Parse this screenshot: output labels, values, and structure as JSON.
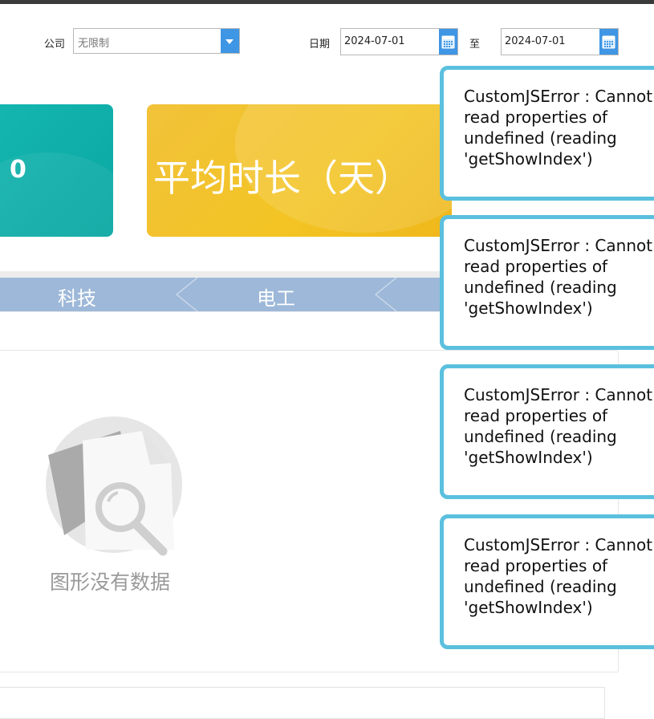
{
  "filters": {
    "company_label": "公司",
    "company_value": "无限制",
    "date_label": "日期",
    "date_from": "2024-07-01",
    "to_label": "至",
    "date_to": "2024-07-01"
  },
  "cards": {
    "teal_value": "0",
    "yellow_title": "平均时长（天）"
  },
  "tabs": [
    "科技",
    "电工"
  ],
  "empty_state": {
    "message": "图形没有数据"
  },
  "errors": [
    "CustomJSError : Cannot read properties of undefined (reading 'getShowIndex')",
    "CustomJSError : Cannot read properties of undefined (reading 'getShowIndex')",
    "CustomJSError : Cannot read properties of undefined (reading 'getShowIndex')",
    "CustomJSError : Cannot read properties of undefined (reading 'getShowIndex')"
  ],
  "colors": {
    "accent_blue": "#3e96e4",
    "teal": "#0aa7a2",
    "yellow": "#f3c423",
    "tab_band": "#9db8d8",
    "toast_border": "#5bc0de"
  },
  "icons": {
    "dropdown": "chevron-down-icon",
    "calendar": "calendar-icon",
    "empty": "no-data-search-icon"
  }
}
